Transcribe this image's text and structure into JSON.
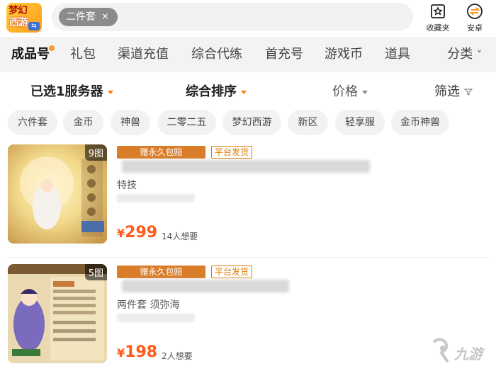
{
  "app": {
    "logo_line1": "梦幻",
    "logo_line2": "西游"
  },
  "search": {
    "chip_label": "二件套",
    "chip_close": "×"
  },
  "header_actions": [
    {
      "label": "收藏夹",
      "icon": "star-bookmark-icon"
    },
    {
      "label": "安卓",
      "icon": "android-swap-icon"
    }
  ],
  "categories": {
    "items": [
      "成品号",
      "礼包",
      "渠道充值",
      "综合代练",
      "首充号",
      "游戏币",
      "道具"
    ],
    "active_index": 0,
    "more_label": "分类",
    "more_caret": "˅"
  },
  "filters": {
    "server": "已选1服务器",
    "sort": "综合排序",
    "price": "价格",
    "screen": "筛选",
    "screen_icon": "filter-funnel-icon"
  },
  "tags": [
    "六件套",
    "金币",
    "神兽",
    "二零二五",
    "梦幻西游",
    "新区",
    "轻享服",
    "金币神兽"
  ],
  "listings": [
    {
      "image_count": "9图",
      "badge_gift": "赠永久包赔",
      "badge_platform": "平台发货",
      "subtitle": "特技",
      "price_currency": "¥",
      "price": "299",
      "wanted": "14人想要"
    },
    {
      "image_count": "5图",
      "badge_gift": "赠永久包赔",
      "badge_platform": "平台发货",
      "subtitle": "两件套 须弥海",
      "price_currency": "¥",
      "price": "198",
      "wanted": "2人想要"
    }
  ],
  "watermark": {
    "text": "九游"
  },
  "colors": {
    "accent": "#ff7a00",
    "price": "#ff5a1a",
    "badge_gift": "#d97d2a"
  }
}
